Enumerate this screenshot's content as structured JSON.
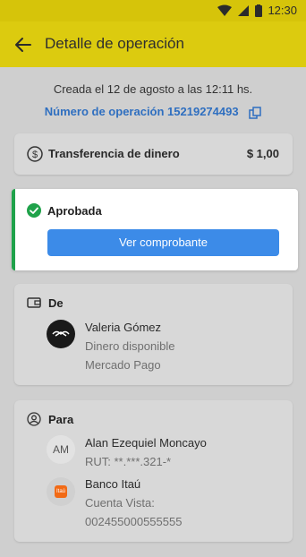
{
  "status_bar": {
    "time": "12:30"
  },
  "app_bar": {
    "title": "Detalle de operación"
  },
  "created": {
    "text": "Creada el 12 de agosto a las 12:11 hs."
  },
  "operation": {
    "label": "Número de operación 15219274493"
  },
  "transfer": {
    "label": "Transferencia de dinero",
    "amount": "$ 1,00"
  },
  "status": {
    "label": "Aprobada",
    "button_label": "Ver comprobante"
  },
  "from": {
    "title": "De",
    "name": "Valeria Gómez",
    "line2": "Dinero disponible",
    "line3": "Mercado Pago"
  },
  "to": {
    "title": "Para",
    "avatar_initials": "AM",
    "name": "Alan Ezequiel Moncayo",
    "rut": "RUT: **.***.321-*",
    "bank_name": "Banco Itaú",
    "bank_badge": "Itaú",
    "account_type": "Cuenta Vista:",
    "account_number": "002455000555555"
  },
  "colors": {
    "accent_yellow": "#dccb0f",
    "link_blue": "#2f6fc0",
    "button_blue": "#3c8be8",
    "success_green": "#1fa24a"
  }
}
